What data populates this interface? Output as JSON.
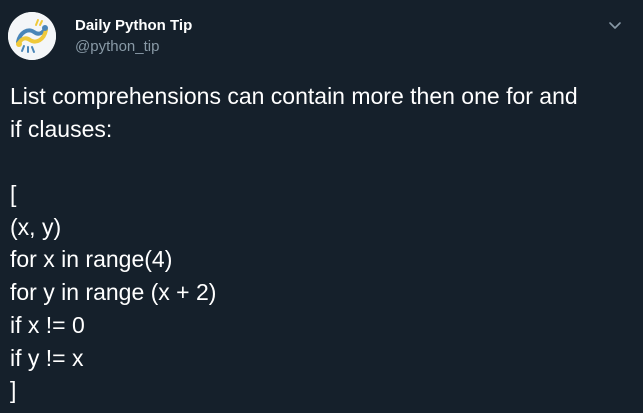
{
  "author": {
    "name": "Daily Python Tip",
    "handle": "@python_tip"
  },
  "tweet": {
    "text_lines": [
      "List comprehensions can contain more then one for and",
      "if clauses:",
      "",
      "[",
      "(x, y)",
      "for x in range(4)",
      "for y in range (x + 2)",
      "if x != 0",
      "if y != x",
      "]"
    ]
  },
  "icons": {
    "avatar": "python-snakes-logo",
    "menu": "chevron-down-icon"
  },
  "colors": {
    "background": "#15202b",
    "text": "#ffffff",
    "secondary": "#8899a6",
    "logo_blue": "#4a86b8",
    "logo_yellow": "#f0c93a"
  }
}
